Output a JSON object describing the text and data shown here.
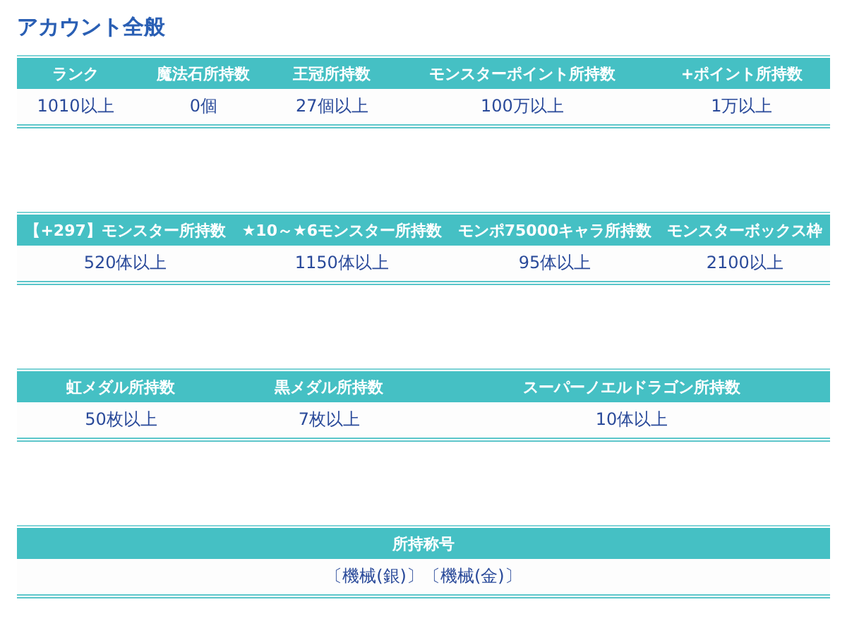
{
  "title": "アカウント全般",
  "tables": [
    {
      "columns": [
        "ランク",
        "魔法石所持数",
        "王冠所持数",
        "モンスターポイント所持数",
        "+ポイント所持数"
      ],
      "rows": [
        [
          "1010以上",
          "0個",
          "27個以上",
          "100万以上",
          "1万以上"
        ]
      ]
    },
    {
      "columns": [
        "【+297】モンスター所持数",
        "★10～★6モンスター所持数",
        "モンポ75000キャラ所持数",
        "モンスターボックス枠"
      ],
      "rows": [
        [
          "520体以上",
          "1150体以上",
          "95体以上",
          "2100以上"
        ]
      ]
    },
    {
      "columns": [
        "虹メダル所持数",
        "黒メダル所持数",
        "スーパーノエルドラゴン所持数"
      ],
      "rows": [
        [
          "50枚以上",
          "7枚以上",
          "10体以上"
        ]
      ]
    },
    {
      "columns": [
        "所持称号"
      ],
      "rows": [
        [
          "〔機械(銀)〕〔機械(金)〕"
        ]
      ]
    }
  ]
}
